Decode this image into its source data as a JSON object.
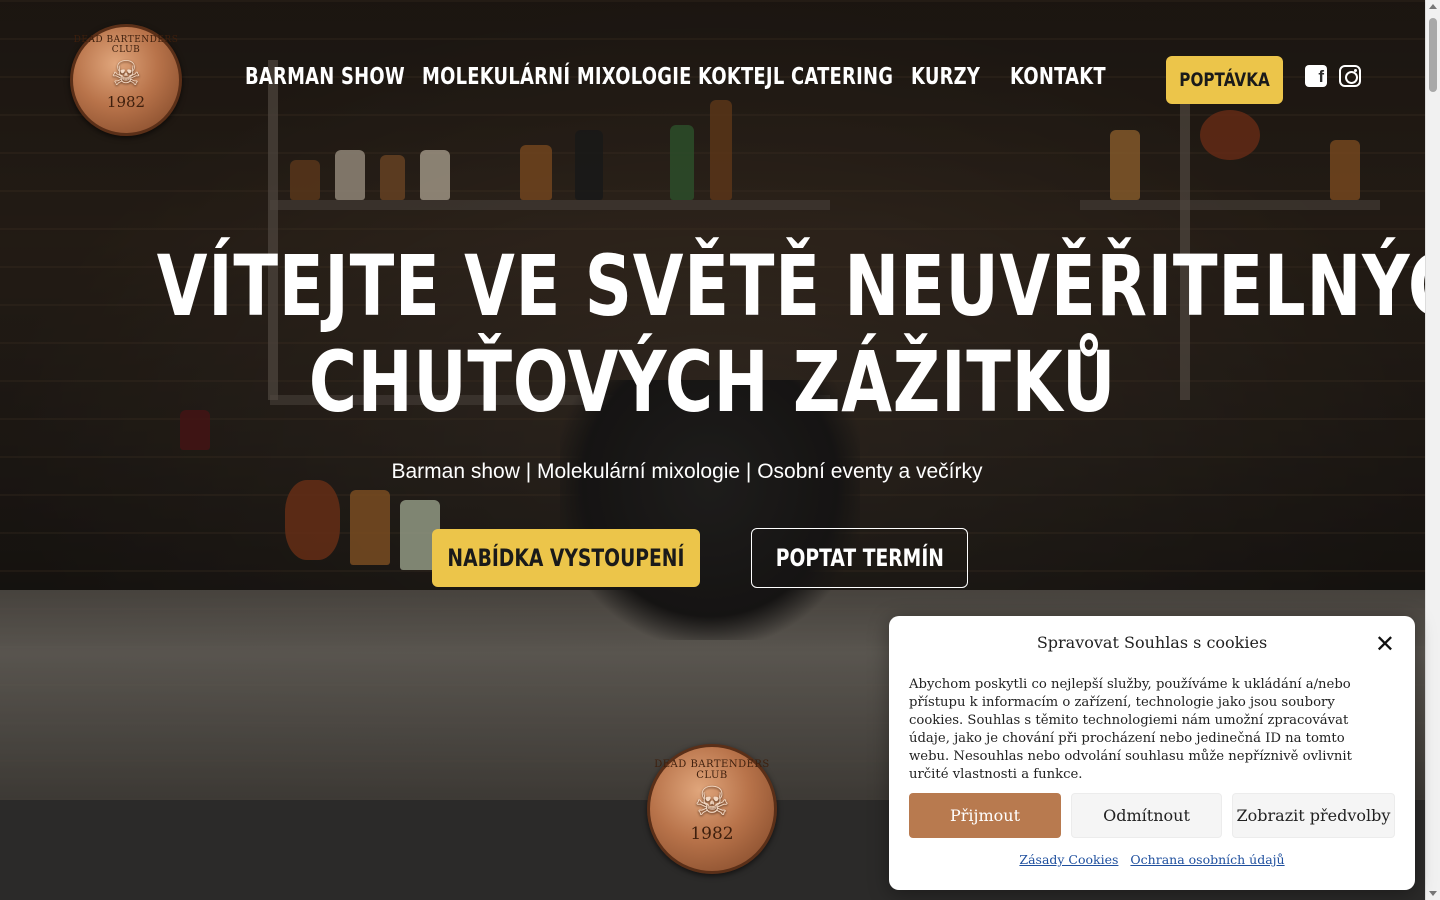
{
  "logo": {
    "ring_text": "DEAD BARTENDERS CLUB",
    "year": "1982"
  },
  "nav": {
    "items": [
      {
        "label": "BARMAN SHOW"
      },
      {
        "label": "MOLEKULÁRNÍ MIXOLOGIE"
      },
      {
        "label": "KOKTEJL CATERING"
      },
      {
        "label": "KURZY"
      },
      {
        "label": "KONTAKT"
      }
    ],
    "cta_label": "POPTÁVKA",
    "social": [
      "facebook-icon",
      "instagram-icon"
    ]
  },
  "hero": {
    "headline_line1": "VÍTEJTE VE SVĚTĚ NEUVĚŘITELNÝCH",
    "headline_line2": "CHUŤOVÝCH ZÁŽITKŮ",
    "subline": "Barman show | Molekulární mixologie | Osobní eventy a večírky",
    "cta_primary": "NABÍDKA VYSTOUPENÍ",
    "cta_secondary": "POPTAT TERMÍN"
  },
  "cookie": {
    "title": "Spravovat Souhlas s cookies",
    "text": "Abychom poskytli co nejlepší služby, používáme k ukládání a/nebo přístupu k informacím o zařízení, technologie jako jsou soubory cookies. Souhlas s těmito technologiemi nám umožní zpracovávat údaje, jako je chování při procházení nebo jedinečná ID na tomto webu. Nesouhlas nebo odvolání souhlasu může nepříznivě ovlivnit určité vlastnosti a funkce.",
    "accept": "Přijmout",
    "deny": "Odmítnout",
    "prefs": "Zobrazit předvolby",
    "link_cookies": "Zásady Cookies",
    "link_privacy": "Ochrana osobních údajů"
  },
  "colors": {
    "accent": "#ecc54a",
    "accept_button": "#b87a4f",
    "dark_section": "#2b2a29"
  }
}
